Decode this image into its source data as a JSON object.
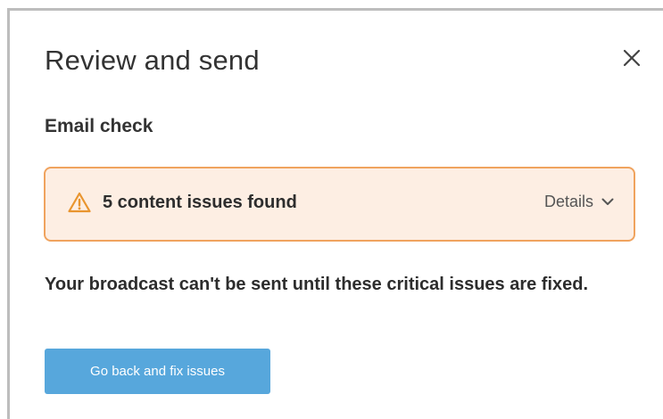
{
  "dialog": {
    "title": "Review and send",
    "close_icon": "close-icon"
  },
  "email_check": {
    "heading": "Email check",
    "alert": {
      "icon": "warning-triangle-icon",
      "text": "5 content issues found",
      "details_label": "Details",
      "details_icon": "chevron-down-icon",
      "accent_color": "#f0a35e",
      "background_color": "#fdeee3"
    },
    "message": "Your broadcast can't be sent until these critical issues are fixed.",
    "action_button_label": "Go back and fix issues",
    "action_button_color": "#57a7dc"
  }
}
